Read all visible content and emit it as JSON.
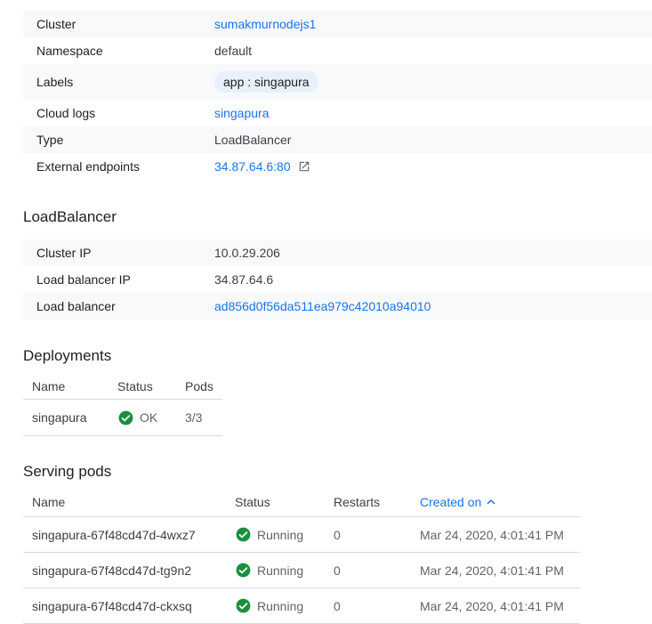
{
  "details": {
    "cluster_label": "Cluster",
    "cluster_value": "sumakmurnodejs1",
    "namespace_label": "Namespace",
    "namespace_value": "default",
    "labels_label": "Labels",
    "labels_chip": "app : singapura",
    "cloud_logs_label": "Cloud logs",
    "cloud_logs_value": "singapura",
    "type_label": "Type",
    "type_value": "LoadBalancer",
    "external_endpoints_label": "External endpoints",
    "external_endpoints_value": "34.87.64.6:80"
  },
  "loadbalancer": {
    "title": "LoadBalancer",
    "cluster_ip_label": "Cluster IP",
    "cluster_ip_value": "10.0.29.206",
    "lb_ip_label": "Load balancer IP",
    "lb_ip_value": "34.87.64.6",
    "lb_label": "Load balancer",
    "lb_value": "ad856d0f56da511ea979c42010a94010"
  },
  "deployments": {
    "title": "Deployments",
    "headers": {
      "name": "Name",
      "status": "Status",
      "pods": "Pods"
    },
    "rows": [
      {
        "name": "singapura",
        "status": "OK",
        "pods": "3/3"
      }
    ]
  },
  "serving_pods": {
    "title": "Serving pods",
    "headers": {
      "name": "Name",
      "status": "Status",
      "restarts": "Restarts",
      "created_on": "Created on"
    },
    "rows": [
      {
        "name": "singapura-67f48cd47d-4wxz7",
        "status": "Running",
        "restarts": "0",
        "created_on": "Mar 24, 2020, 4:01:41 PM"
      },
      {
        "name": "singapura-67f48cd47d-tg9n2",
        "status": "Running",
        "restarts": "0",
        "created_on": "Mar 24, 2020, 4:01:41 PM"
      },
      {
        "name": "singapura-67f48cd47d-ckxsq",
        "status": "Running",
        "restarts": "0",
        "created_on": "Mar 24, 2020, 4:01:41 PM"
      }
    ]
  },
  "colors": {
    "link": "#1a73e8",
    "ok_green": "#1e8e3e",
    "chip_bg": "#e8f0fe",
    "row_shade": "#f8f9fa"
  },
  "icons": {
    "status_ok": "check-circle-icon",
    "external": "open-in-new-icon",
    "sort": "arrow-up-icon"
  }
}
